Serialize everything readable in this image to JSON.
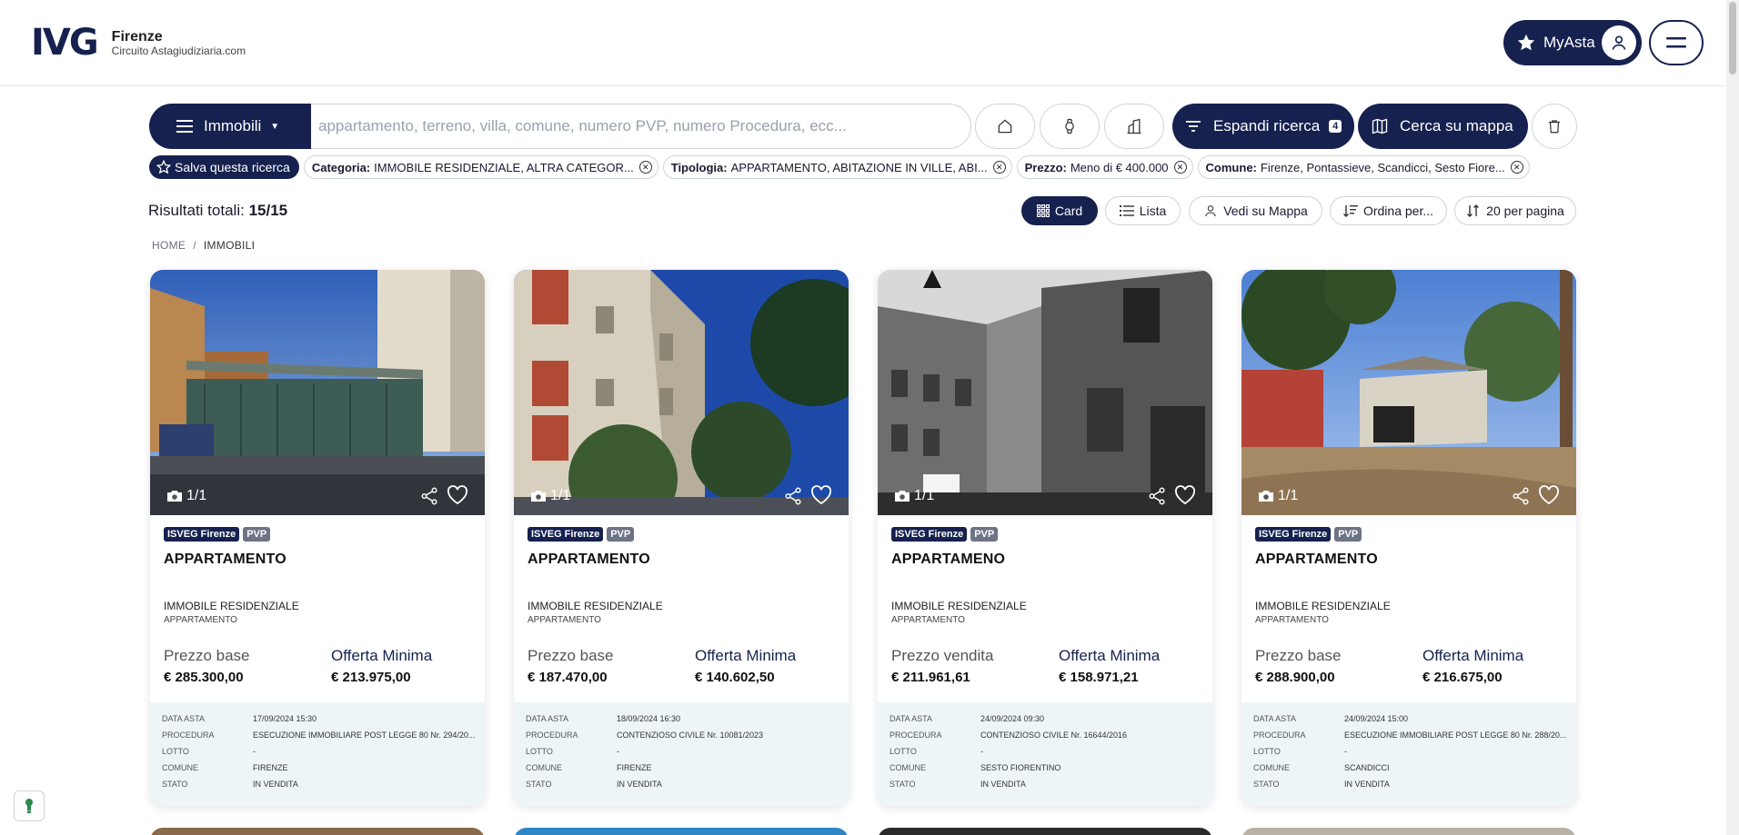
{
  "header": {
    "logo": "IVG",
    "city": "Firenze",
    "subtitle": "Circuito Astagiudiziaria.com",
    "myasta_label": "MyAsta"
  },
  "search": {
    "category_label": "Immobili",
    "placeholder": "appartamento, terreno, villa, comune, numero PVP, numero Procedura, ecc...",
    "expand_label": "Espandi ricerca",
    "expand_count": "4",
    "map_label": "Cerca su mappa"
  },
  "filters": {
    "save_label": "Salva questa ricerca",
    "chips": [
      {
        "key": "Categoria:",
        "value": "IMMOBILE RESIDENZIALE, ALTRA CATEGOR..."
      },
      {
        "key": "Tipologia:",
        "value": "APPARTAMENTO, ABITAZIONE IN VILLE, ABI..."
      },
      {
        "key": "Prezzo:",
        "value": "Meno di € 400.000"
      },
      {
        "key": "Comune:",
        "value": "Firenze, Pontassieve, Scandicci, Sesto Fiore..."
      }
    ]
  },
  "results": {
    "label": "Risultati totali:",
    "count": "15/15"
  },
  "view": {
    "card": "Card",
    "list": "Lista",
    "map": "Vedi su Mappa",
    "sort": "Ordina per...",
    "per_page": "20 per pagina"
  },
  "breadcrumb": {
    "home": "HOME",
    "separator": "/",
    "current": "IMMOBILI"
  },
  "cards": [
    {
      "photo_count": "1/1",
      "badge_agency": "ISVEG Firenze",
      "badge_pvp": "PVP",
      "title": "APPARTAMENTO",
      "category": "IMMOBILE RESIDENZIALE",
      "type": "APPARTAMENTO",
      "price_label": "Prezzo base",
      "price": "€ 285.300,00",
      "offer_label": "Offerta Minima",
      "offer": "€ 213.975,00",
      "details": {
        "data_asta_label": "DATA ASTA",
        "data_asta": "17/09/2024 15:30",
        "procedura_label": "PROCEDURA",
        "procedura": "ESECUZIONE IMMOBILIARE POST LEGGE 80 Nr. 294/20...",
        "lotto_label": "LOTTO",
        "lotto": "-",
        "comune_label": "COMUNE",
        "comune": "FIRENZE",
        "stato_label": "STATO",
        "stato": "IN VENDITA"
      }
    },
    {
      "photo_count": "1/1",
      "badge_agency": "ISVEG Firenze",
      "badge_pvp": "PVP",
      "title": "APPARTAMENTO",
      "category": "IMMOBILE RESIDENZIALE",
      "type": "APPARTAMENTO",
      "price_label": "Prezzo base",
      "price": "€ 187.470,00",
      "offer_label": "Offerta Minima",
      "offer": "€ 140.602,50",
      "details": {
        "data_asta_label": "DATA ASTA",
        "data_asta": "18/09/2024 16:30",
        "procedura_label": "PROCEDURA",
        "procedura": "CONTENZIOSO CIVILE Nr. 10081/2023",
        "lotto_label": "LOTTO",
        "lotto": "-",
        "comune_label": "COMUNE",
        "comune": "FIRENZE",
        "stato_label": "STATO",
        "stato": "IN VENDITA"
      }
    },
    {
      "photo_count": "1/1",
      "badge_agency": "ISVEG Firenze",
      "badge_pvp": "PVP",
      "title": "APPARTAMENO",
      "category": "IMMOBILE RESIDENZIALE",
      "type": "APPARTAMENTO",
      "price_label": "Prezzo vendita",
      "price": "€ 211.961,61",
      "offer_label": "Offerta Minima",
      "offer": "€ 158.971,21",
      "details": {
        "data_asta_label": "DATA ASTA",
        "data_asta": "24/09/2024 09:30",
        "procedura_label": "PROCEDURA",
        "procedura": "CONTENZIOSO CIVILE Nr. 16644/2016",
        "lotto_label": "LOTTO",
        "lotto": "-",
        "comune_label": "COMUNE",
        "comune": "SESTO FIORENTINO",
        "stato_label": "STATO",
        "stato": "IN VENDITA"
      }
    },
    {
      "photo_count": "1/1",
      "badge_agency": "ISVEG Firenze",
      "badge_pvp": "PVP",
      "title": "APPARTAMENTO",
      "category": "IMMOBILE RESIDENZIALE",
      "type": "APPARTAMENTO",
      "price_label": "Prezzo base",
      "price": "€ 288.900,00",
      "offer_label": "Offerta Minima",
      "offer": "€ 216.675,00",
      "details": {
        "data_asta_label": "DATA ASTA",
        "data_asta": "24/09/2024 15:00",
        "procedura_label": "PROCEDURA",
        "procedura": "ESECUZIONE IMMOBILIARE POST LEGGE 80 Nr. 288/20...",
        "lotto_label": "LOTTO",
        "lotto": "-",
        "comune_label": "COMUNE",
        "comune": "SCANDICCI",
        "stato_label": "STATO",
        "stato": "IN VENDITA"
      }
    }
  ],
  "colors": {
    "primary": "#16214f",
    "details_bg": "#eef5f6",
    "badge_pvp": "#6e7385"
  }
}
